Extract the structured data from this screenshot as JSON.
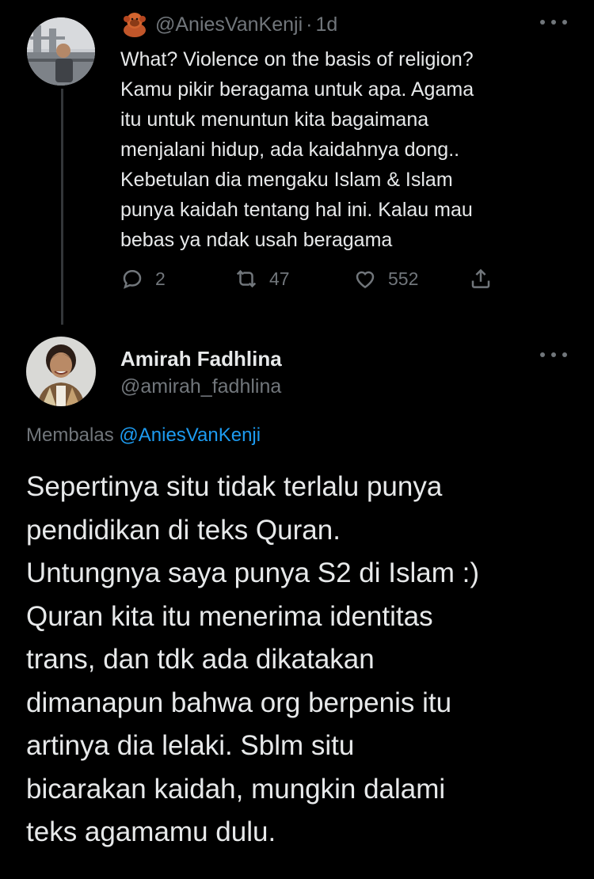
{
  "parent_tweet": {
    "handle": "@AniesVanKenji",
    "separator": "·",
    "time": "1d",
    "lines": [
      "What? Violence on the basis of religion?",
      "Kamu pikir beragama untuk apa. Agama",
      "itu untuk menuntun kita bagaimana",
      "menjalani hidup, ada kaidahnya dong..",
      "Kebetulan dia mengaku Islam & Islam",
      "punya kaidah tentang hal ini. Kalau mau",
      "bebas ya ndak usah beragama"
    ],
    "stats": {
      "replies": "2",
      "retweets": "47",
      "likes": "552"
    },
    "icons": {
      "badge": "orangutan-emoji-icon",
      "more": "more-icon",
      "reply": "reply-icon",
      "retweet": "retweet-icon",
      "like": "heart-icon",
      "share": "share-icon"
    }
  },
  "main_tweet": {
    "display_name": "Amirah Fadhlina",
    "handle": "@amirah_fadhlina",
    "reply_prefix": "Membalas",
    "reply_to": "@AniesVanKenji",
    "lines": [
      "Sepertinya situ tidak terlalu punya",
      "pendidikan di teks Quran.",
      "Untungnya saya punya S2 di Islam :)",
      "Quran kita itu menerima identitas",
      "trans, dan tdk ada dikatakan",
      "dimanapun bahwa org berpenis itu",
      "artinya dia lelaki. Sblm situ",
      "bicarakan kaidah, mungkin dalami",
      "teks agamamu dulu."
    ]
  },
  "colors": {
    "background": "#000000",
    "text_primary": "#e7e9ea",
    "text_secondary": "#71767b",
    "accent": "#1d9bf0",
    "thread_line": "#333639"
  }
}
